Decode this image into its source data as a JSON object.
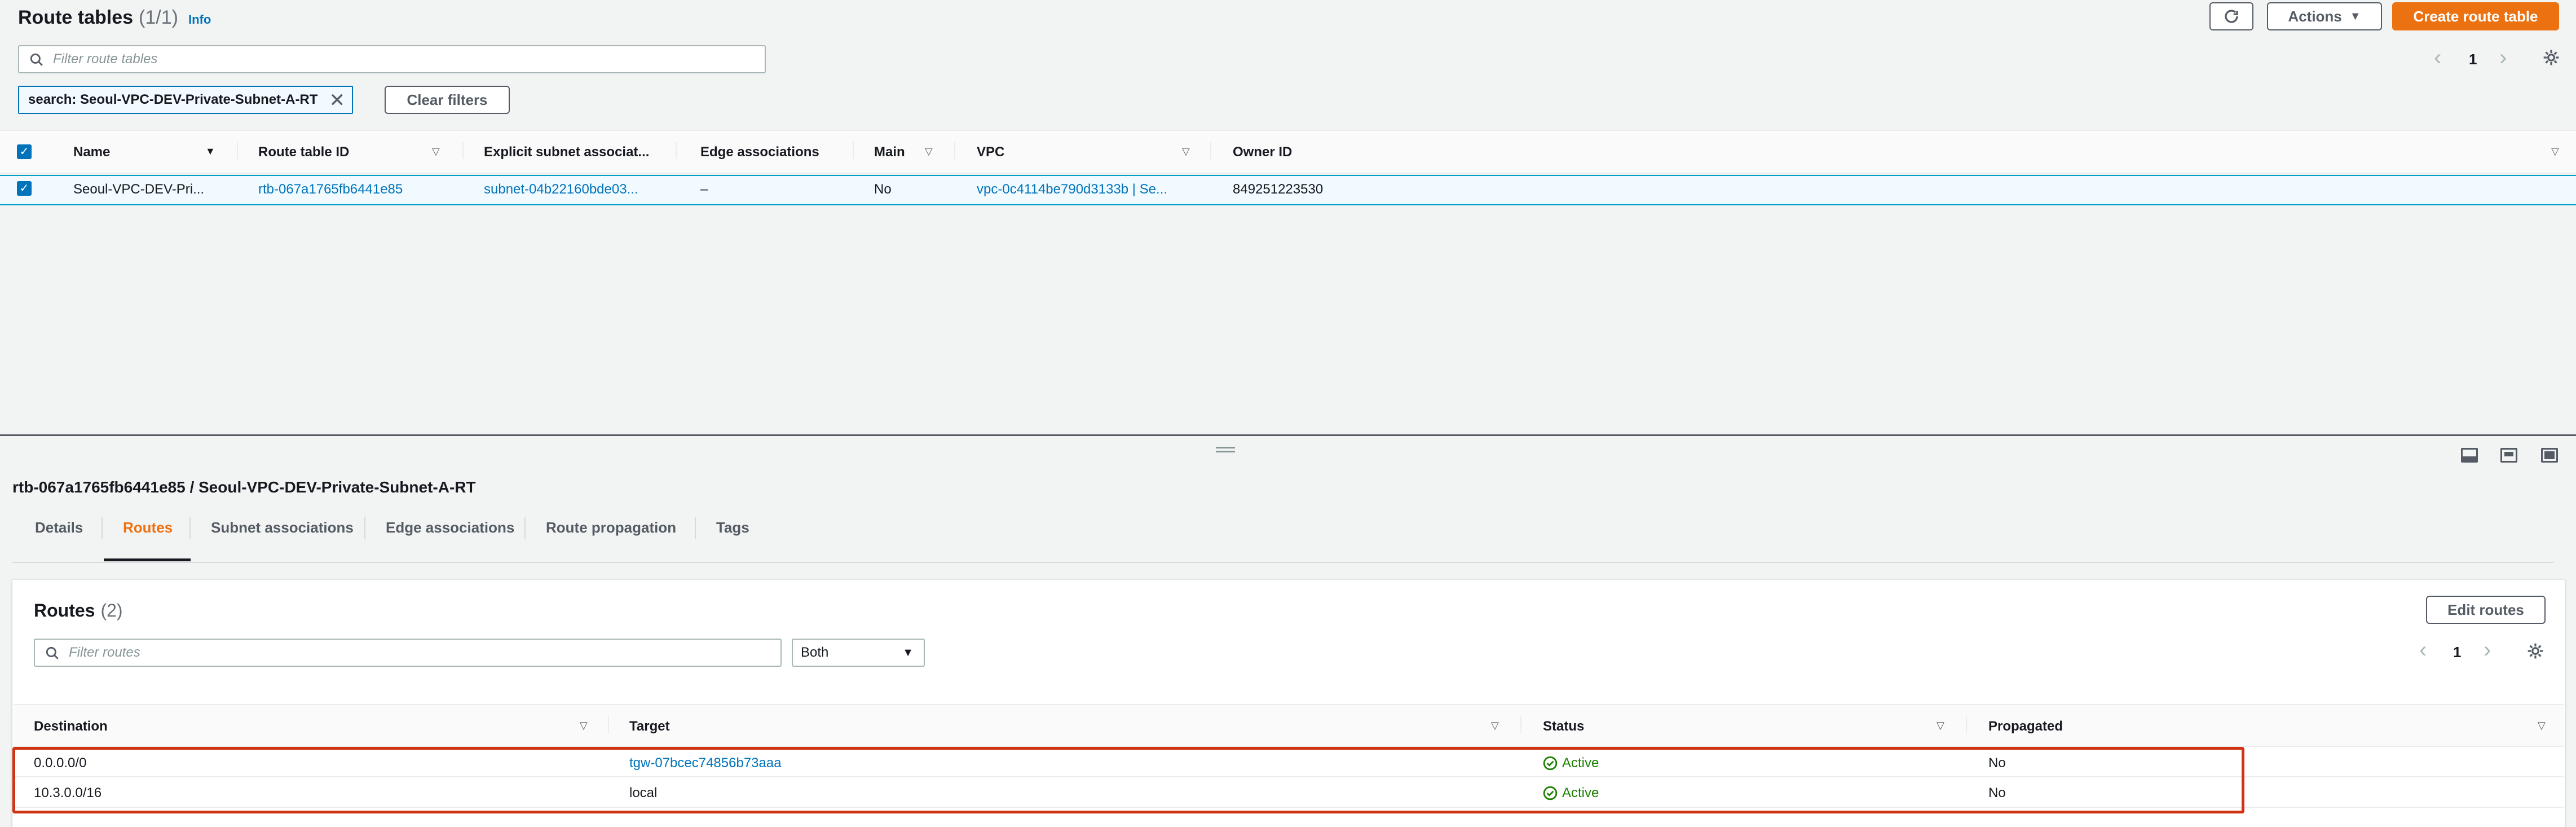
{
  "header": {
    "title": "Route tables",
    "count": "(1/1)",
    "info": "Info",
    "actions_label": "Actions",
    "create_label": "Create route table",
    "page_number": "1"
  },
  "filter": {
    "placeholder": "Filter route tables",
    "token_label": "search: Seoul-VPC-DEV-Private-Subnet-A-RT",
    "clear_label": "Clear filters"
  },
  "table": {
    "columns": [
      "Name",
      "Route table ID",
      "Explicit subnet associat...",
      "Edge associations",
      "Main",
      "VPC",
      "Owner ID"
    ],
    "rows": [
      {
        "name": "Seoul-VPC-DEV-Pri...",
        "id": "rtb-067a1765fb6441e85",
        "subnet": "subnet-04b22160bde03...",
        "edge": "–",
        "main": "No",
        "vpc": "vpc-0c4114be790d3133b | Se...",
        "owner": "849251223530"
      }
    ]
  },
  "detail": {
    "title": "rtb-067a1765fb6441e85 / Seoul-VPC-DEV-Private-Subnet-A-RT",
    "tabs": [
      "Details",
      "Routes",
      "Subnet associations",
      "Edge associations",
      "Route propagation",
      "Tags"
    ],
    "active_tab": "Routes"
  },
  "routes": {
    "title": "Routes",
    "count": "(2)",
    "edit_label": "Edit routes",
    "filter_placeholder": "Filter routes",
    "select_value": "Both",
    "page_number": "1",
    "columns": [
      "Destination",
      "Target",
      "Status",
      "Propagated"
    ],
    "rows": [
      {
        "destination": "0.0.0.0/0",
        "target": "tgw-07bcec74856b73aaa",
        "status": "Active",
        "propagated": "No"
      },
      {
        "destination": "10.3.0.0/16",
        "target": "local",
        "status": "Active",
        "propagated": "No"
      }
    ]
  },
  "colors": {
    "accent": "#ec7211",
    "link": "#0073bb",
    "success": "#1d8102",
    "highlight": "#d13212"
  }
}
